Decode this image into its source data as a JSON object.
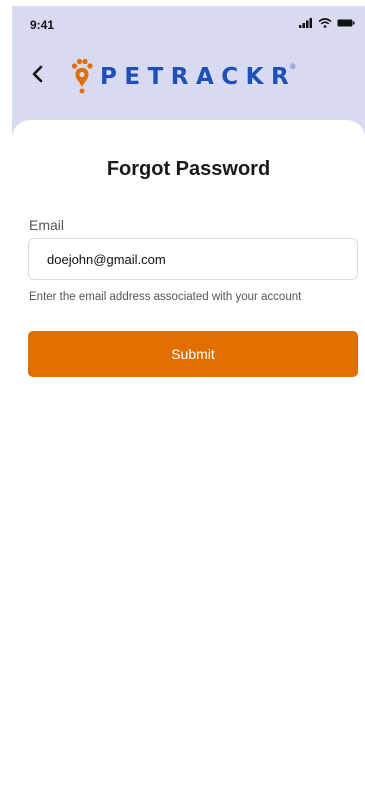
{
  "status_bar": {
    "time": "9:41"
  },
  "header": {
    "back_icon": "chevron-left-icon",
    "logo_text": "PETRACKR",
    "logo_registered": "®"
  },
  "form": {
    "title": "Forgot Password",
    "email_label": "Email",
    "email_value": "doejohn@gmail.com",
    "helper_text": "Enter the email address associated with your account",
    "submit_label": "Submit"
  },
  "colors": {
    "header_background": "#d7daf0",
    "brand_blue": "#1f4fb8",
    "brand_orange": "#e06f00",
    "submit_button": "#e06f00"
  }
}
